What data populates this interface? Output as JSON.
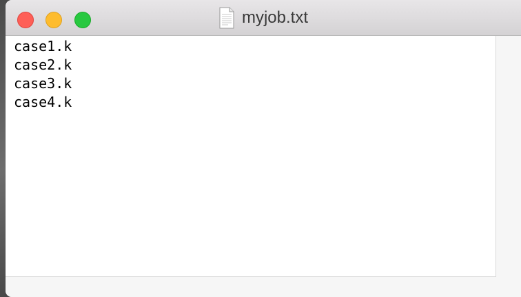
{
  "window": {
    "title": "myjob.txt",
    "icons": {
      "close": "close-icon",
      "minimize": "minimize-icon",
      "zoom": "zoom-icon",
      "document": "text-document-icon"
    },
    "colors": {
      "close": "#fe5f57",
      "minimize": "#febc2e",
      "zoom": "#28c840"
    }
  },
  "document": {
    "lines": [
      "case1.k",
      "case2.k",
      "case3.k",
      "case4.k"
    ]
  }
}
